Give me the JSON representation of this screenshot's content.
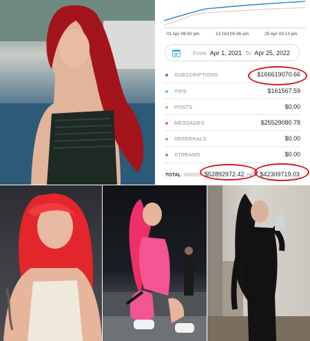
{
  "graph": {
    "axis_labels": [
      "01 Apr 08:00 pm",
      "13 Oct 05:36 am",
      "25 Apr 03:13 pm"
    ]
  },
  "date_range": {
    "from_label": "From",
    "from_value": "Apr 1, 2021",
    "to_label": "To",
    "to_value": "Apr 25, 2022",
    "icon": "calendar-icon"
  },
  "stats": [
    {
      "label": "SUBSCRIPTIONS",
      "value": "$166619070.66",
      "color": "#2f7fd1"
    },
    {
      "label": "TIPS",
      "value": "$161567.59",
      "color": "#4fc9d7"
    },
    {
      "label": "POSTS",
      "value": "$0.00",
      "color": "#f2a14a"
    },
    {
      "label": "MESSAGES",
      "value": "$25529080.78",
      "color": "#ea5d76"
    },
    {
      "label": "REFERRALS",
      "value": "$0.00",
      "color": "#9aa0a6"
    },
    {
      "label": "STREAMS",
      "value": "$0.00",
      "color": "#9c7ad6"
    }
  ],
  "total": {
    "label": "TOTAL",
    "gross_label": "GROSS",
    "gross_value": "$52892972.42",
    "net_label": "NET",
    "net_value": "$42309719.03"
  },
  "colors": {
    "highlight_ring": "#d4151b",
    "graph_line_primary": "#3a8ad8",
    "graph_line_secondary": "#f0b6bc"
  }
}
